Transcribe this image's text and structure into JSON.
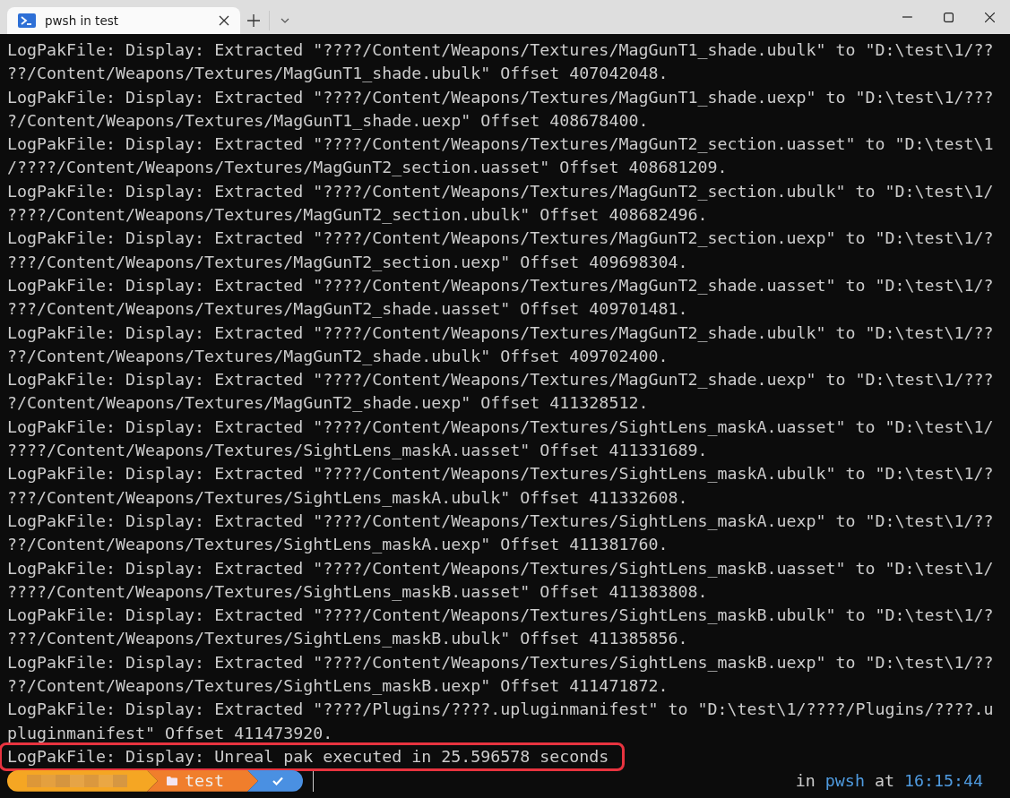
{
  "window": {
    "tab_title": "pwsh in test",
    "tab_selected": true
  },
  "log_lines": [
    {
      "text": "LogPakFile: Display: Extracted \"????/Content/Weapons/Textures/MagGunT1_shade.ubulk\" to \"D:\\test\\1/????/Content/Weapons/Textures/MagGunT1_shade.ubulk\" Offset 407042048.",
      "highlighted": false
    },
    {
      "text": "LogPakFile: Display: Extracted \"????/Content/Weapons/Textures/MagGunT1_shade.uexp\" to \"D:\\test\\1/????/Content/Weapons/Textures/MagGunT1_shade.uexp\" Offset 408678400.",
      "highlighted": false
    },
    {
      "text": "LogPakFile: Display: Extracted \"????/Content/Weapons/Textures/MagGunT2_section.uasset\" to \"D:\\test\\1/????/Content/Weapons/Textures/MagGunT2_section.uasset\" Offset 408681209.",
      "highlighted": false
    },
    {
      "text": "LogPakFile: Display: Extracted \"????/Content/Weapons/Textures/MagGunT2_section.ubulk\" to \"D:\\test\\1/????/Content/Weapons/Textures/MagGunT2_section.ubulk\" Offset 408682496.",
      "highlighted": false
    },
    {
      "text": "LogPakFile: Display: Extracted \"????/Content/Weapons/Textures/MagGunT2_section.uexp\" to \"D:\\test\\1/????/Content/Weapons/Textures/MagGunT2_section.uexp\" Offset 409698304.",
      "highlighted": false
    },
    {
      "text": "LogPakFile: Display: Extracted \"????/Content/Weapons/Textures/MagGunT2_shade.uasset\" to \"D:\\test\\1/????/Content/Weapons/Textures/MagGunT2_shade.uasset\" Offset 409701481.",
      "highlighted": false
    },
    {
      "text": "LogPakFile: Display: Extracted \"????/Content/Weapons/Textures/MagGunT2_shade.ubulk\" to \"D:\\test\\1/????/Content/Weapons/Textures/MagGunT2_shade.ubulk\" Offset 409702400.",
      "highlighted": false
    },
    {
      "text": "LogPakFile: Display: Extracted \"????/Content/Weapons/Textures/MagGunT2_shade.uexp\" to \"D:\\test\\1/????/Content/Weapons/Textures/MagGunT2_shade.uexp\" Offset 411328512.",
      "highlighted": false
    },
    {
      "text": "LogPakFile: Display: Extracted \"????/Content/Weapons/Textures/SightLens_maskA.uasset\" to \"D:\\test\\1/????/Content/Weapons/Textures/SightLens_maskA.uasset\" Offset 411331689.",
      "highlighted": false
    },
    {
      "text": "LogPakFile: Display: Extracted \"????/Content/Weapons/Textures/SightLens_maskA.ubulk\" to \"D:\\test\\1/????/Content/Weapons/Textures/SightLens_maskA.ubulk\" Offset 411332608.",
      "highlighted": false
    },
    {
      "text": "LogPakFile: Display: Extracted \"????/Content/Weapons/Textures/SightLens_maskA.uexp\" to \"D:\\test\\1/????/Content/Weapons/Textures/SightLens_maskA.uexp\" Offset 411381760.",
      "highlighted": false
    },
    {
      "text": "LogPakFile: Display: Extracted \"????/Content/Weapons/Textures/SightLens_maskB.uasset\" to \"D:\\test\\1/????/Content/Weapons/Textures/SightLens_maskB.uasset\" Offset 411383808.",
      "highlighted": false
    },
    {
      "text": "LogPakFile: Display: Extracted \"????/Content/Weapons/Textures/SightLens_maskB.ubulk\" to \"D:\\test\\1/????/Content/Weapons/Textures/SightLens_maskB.ubulk\" Offset 411385856.",
      "highlighted": false
    },
    {
      "text": "LogPakFile: Display: Extracted \"????/Content/Weapons/Textures/SightLens_maskB.uexp\" to \"D:\\test\\1/????/Content/Weapons/Textures/SightLens_maskB.uexp\" Offset 411471872.",
      "highlighted": false
    },
    {
      "text": "LogPakFile: Display: Extracted \"????/Plugins/????.upluginmanifest\" to \"D:\\test\\1/????/Plugins/????.upluginmanifest\" Offset 411473920.",
      "highlighted": false
    },
    {
      "text": "LogPakFile: Display: Unreal pak executed in 25.596578 seconds",
      "highlighted": true
    }
  ],
  "prompt": {
    "segments": [
      {
        "kind": "blurred",
        "color": "#f5a623"
      },
      {
        "kind": "folder",
        "text": "test",
        "color": "#f07e2c"
      },
      {
        "kind": "status",
        "color": "#4a90e2"
      }
    ],
    "in_label": "in",
    "shell": "pwsh",
    "at_label": "at",
    "time": "16:15:44"
  }
}
